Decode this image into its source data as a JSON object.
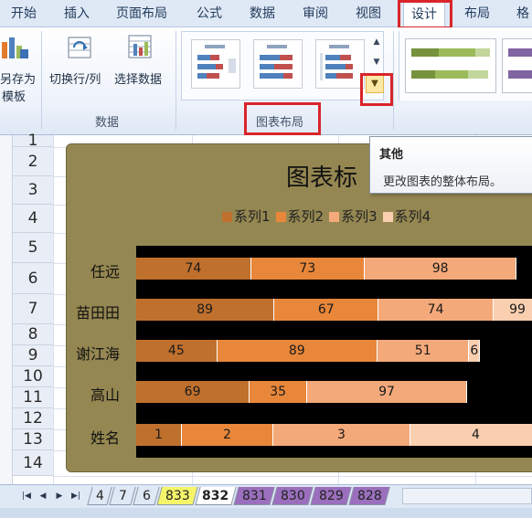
{
  "ribbon": {
    "tabs": [
      {
        "label": "开始"
      },
      {
        "label": "插入"
      },
      {
        "label": "页面布局"
      },
      {
        "label": "公式"
      },
      {
        "label": "数据"
      },
      {
        "label": "审阅"
      },
      {
        "label": "视图"
      },
      {
        "label": "设计",
        "active": true
      },
      {
        "label": "布局"
      },
      {
        "label": "格"
      }
    ],
    "save_template_label_1": "另存为",
    "save_template_label_2": "模板",
    "switch_row_col_label": "切换行/列",
    "select_data_label": "选择数据",
    "data_group_label": "数据",
    "chart_layout_group_label": "图表布局",
    "more_button_glyph": "▼",
    "scroll_up_glyph": "▲",
    "scroll_down_glyph": "▼"
  },
  "tooltip": {
    "title": "其他",
    "body": "更改图表的整体布局。"
  },
  "rows": [
    "1",
    "2",
    "3",
    "4",
    "5",
    "6",
    "7",
    "8",
    "9",
    "10",
    "11",
    "12",
    "13",
    "14"
  ],
  "chart_data": {
    "type": "bar",
    "orientation": "horizontal",
    "stacked": true,
    "title": "图表标",
    "categories": [
      "任远",
      "苗田田",
      "谢江海",
      "高山",
      "姓名"
    ],
    "series": [
      {
        "name": "系列1",
        "color": "#c0702d",
        "values": [
          74,
          89,
          45,
          69,
          1
        ]
      },
      {
        "name": "系列2",
        "color": "#e8873a",
        "values": [
          73,
          67,
          89,
          35,
          2
        ]
      },
      {
        "name": "系列3",
        "color": "#f4a97a",
        "values": [
          98,
          74,
          51,
          97,
          3
        ]
      },
      {
        "name": "系列4",
        "color": "#f9cfb0",
        "values": [
          null,
          99,
          6,
          null,
          4
        ]
      }
    ],
    "plot_background": "#000000",
    "chart_background": "#958751",
    "legend_position": "top"
  },
  "sheet_tabs": [
    {
      "label": "4",
      "color": "#dfe8f5"
    },
    {
      "label": "7",
      "color": "#dfe8f5"
    },
    {
      "label": "6",
      "color": "#dfe8f5"
    },
    {
      "label": "833",
      "color": "#f5f56a"
    },
    {
      "label": "832",
      "color": "#ffffff",
      "active": true
    },
    {
      "label": "831",
      "color": "#9b6fbd"
    },
    {
      "label": "830",
      "color": "#9b6fbd"
    },
    {
      "label": "829",
      "color": "#9b6fbd"
    },
    {
      "label": "828",
      "color": "#9b6fbd"
    }
  ],
  "nav_glyphs": {
    "first": "|◀",
    "prev": "◀",
    "next": "▶",
    "last": "▶|"
  },
  "colors": {
    "highlight_red": "#d9252a"
  }
}
